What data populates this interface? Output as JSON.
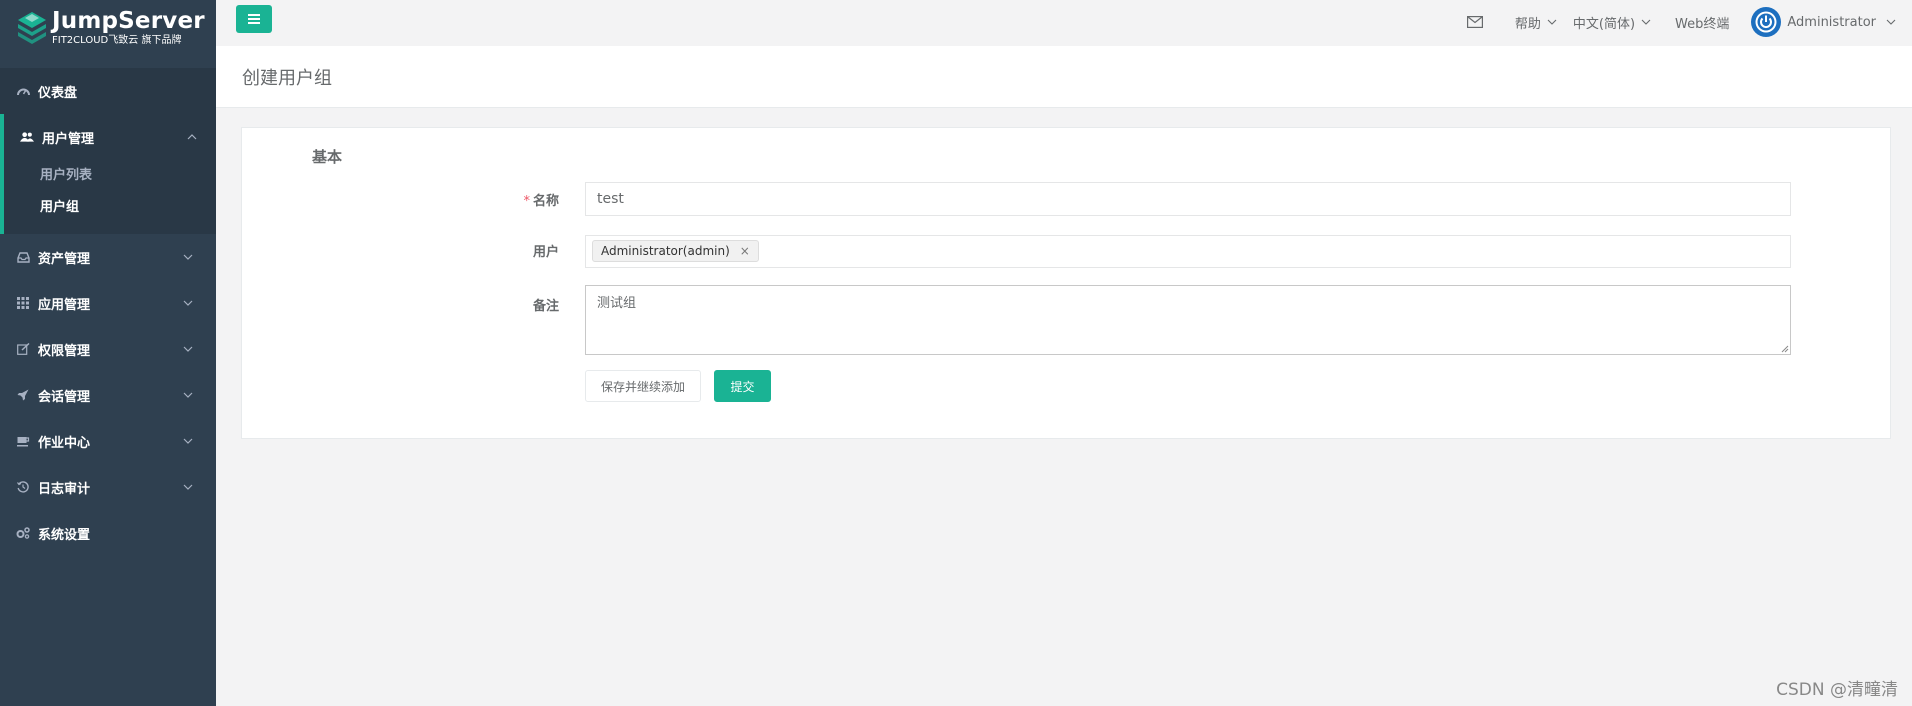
{
  "brand": {
    "name": "JumpServer",
    "tagline": "FIT2CLOUD飞致云 旗下品牌",
    "accent": "#1ab394",
    "sidebar_bg": "#2f4050"
  },
  "sidebar": {
    "items": [
      {
        "label": "仪表盘",
        "icon": "dashboard-icon"
      },
      {
        "label": "用户管理",
        "icon": "users-icon",
        "expanded": true,
        "children": [
          {
            "label": "用户列表"
          },
          {
            "label": "用户组",
            "active": true
          }
        ]
      },
      {
        "label": "资产管理",
        "icon": "inbox-icon"
      },
      {
        "label": "应用管理",
        "icon": "grid-icon"
      },
      {
        "label": "权限管理",
        "icon": "edit-icon"
      },
      {
        "label": "会话管理",
        "icon": "rocket-icon"
      },
      {
        "label": "作业中心",
        "icon": "coffee-icon"
      },
      {
        "label": "日志审计",
        "icon": "history-icon"
      },
      {
        "label": "系统设置",
        "icon": "gears-icon"
      }
    ]
  },
  "topbar": {
    "mail_icon": "mail-icon",
    "help": "帮助",
    "language": "中文(简体)",
    "web_terminal": "Web终端",
    "user": "Administrator"
  },
  "page": {
    "title": "创建用户组"
  },
  "form": {
    "section": "基本",
    "name_label": "名称",
    "name_value": "test",
    "users_label": "用户",
    "users_selected": [
      "Administrator(admin)"
    ],
    "comment_label": "备注",
    "comment_value": "测试组",
    "save_continue": "保存并继续添加",
    "submit": "提交"
  },
  "watermark": "CSDN @清疃清"
}
